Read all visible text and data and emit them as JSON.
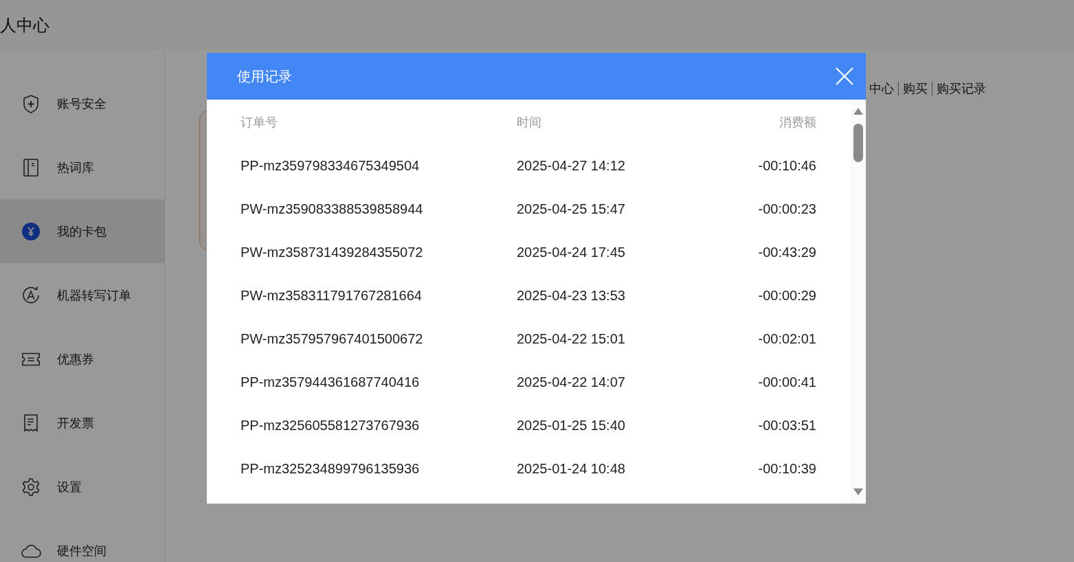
{
  "page": {
    "title": "人中心"
  },
  "sidebar": {
    "items": [
      {
        "label": "账号安全",
        "selected": false
      },
      {
        "label": "热词库",
        "selected": false
      },
      {
        "label": "我的卡包",
        "selected": true
      },
      {
        "label": "机器转写订单",
        "selected": false
      },
      {
        "label": "优惠券",
        "selected": false
      },
      {
        "label": "开发票",
        "selected": false
      },
      {
        "label": "设置",
        "selected": false
      },
      {
        "label": "硬件空间",
        "selected": false
      }
    ]
  },
  "links": [
    "中心",
    "购买",
    "购买记录"
  ],
  "dialog": {
    "title": "使用记录",
    "columns": [
      "订单号",
      "时间",
      "消费额"
    ],
    "rows": [
      [
        "PP-mz359798334675349504",
        "2025-04-27 14:12",
        "-00:10:46"
      ],
      [
        "PW-mz359083388539858944",
        "2025-04-25 15:47",
        "-00:00:23"
      ],
      [
        "PW-mz358731439284355072",
        "2025-04-24 17:45",
        "-00:43:29"
      ],
      [
        "PW-mz358311791767281664",
        "2025-04-23 13:53",
        "-00:00:29"
      ],
      [
        "PW-mz357957967401500672",
        "2025-04-22 15:01",
        "-00:02:01"
      ],
      [
        "PP-mz357944361687740416",
        "2025-04-22 14:07",
        "-00:00:41"
      ],
      [
        "PP-mz325605581273767936",
        "2025-01-25 15:40",
        "-00:03:51"
      ],
      [
        "PP-mz325234899796135936",
        "2025-01-24 10:48",
        "-00:10:39"
      ]
    ]
  }
}
